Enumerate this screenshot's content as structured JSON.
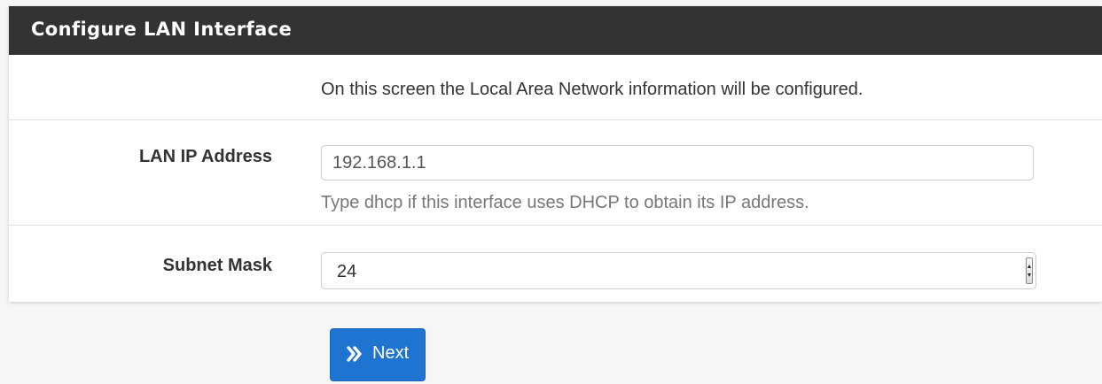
{
  "panel": {
    "title": "Configure LAN Interface",
    "description": "On this screen the Local Area Network information will be configured."
  },
  "lan_ip": {
    "label": "LAN IP Address",
    "value": "192.168.1.1",
    "help": "Type dhcp if this interface uses DHCP to obtain its IP address."
  },
  "subnet_mask": {
    "label": "Subnet Mask",
    "selected": "24"
  },
  "next_button": {
    "label": "Next",
    "icon": "double-chevron-right-icon"
  },
  "colors": {
    "header_bg": "#333333",
    "button_bg": "#1e74d0",
    "help_text": "#777777"
  }
}
